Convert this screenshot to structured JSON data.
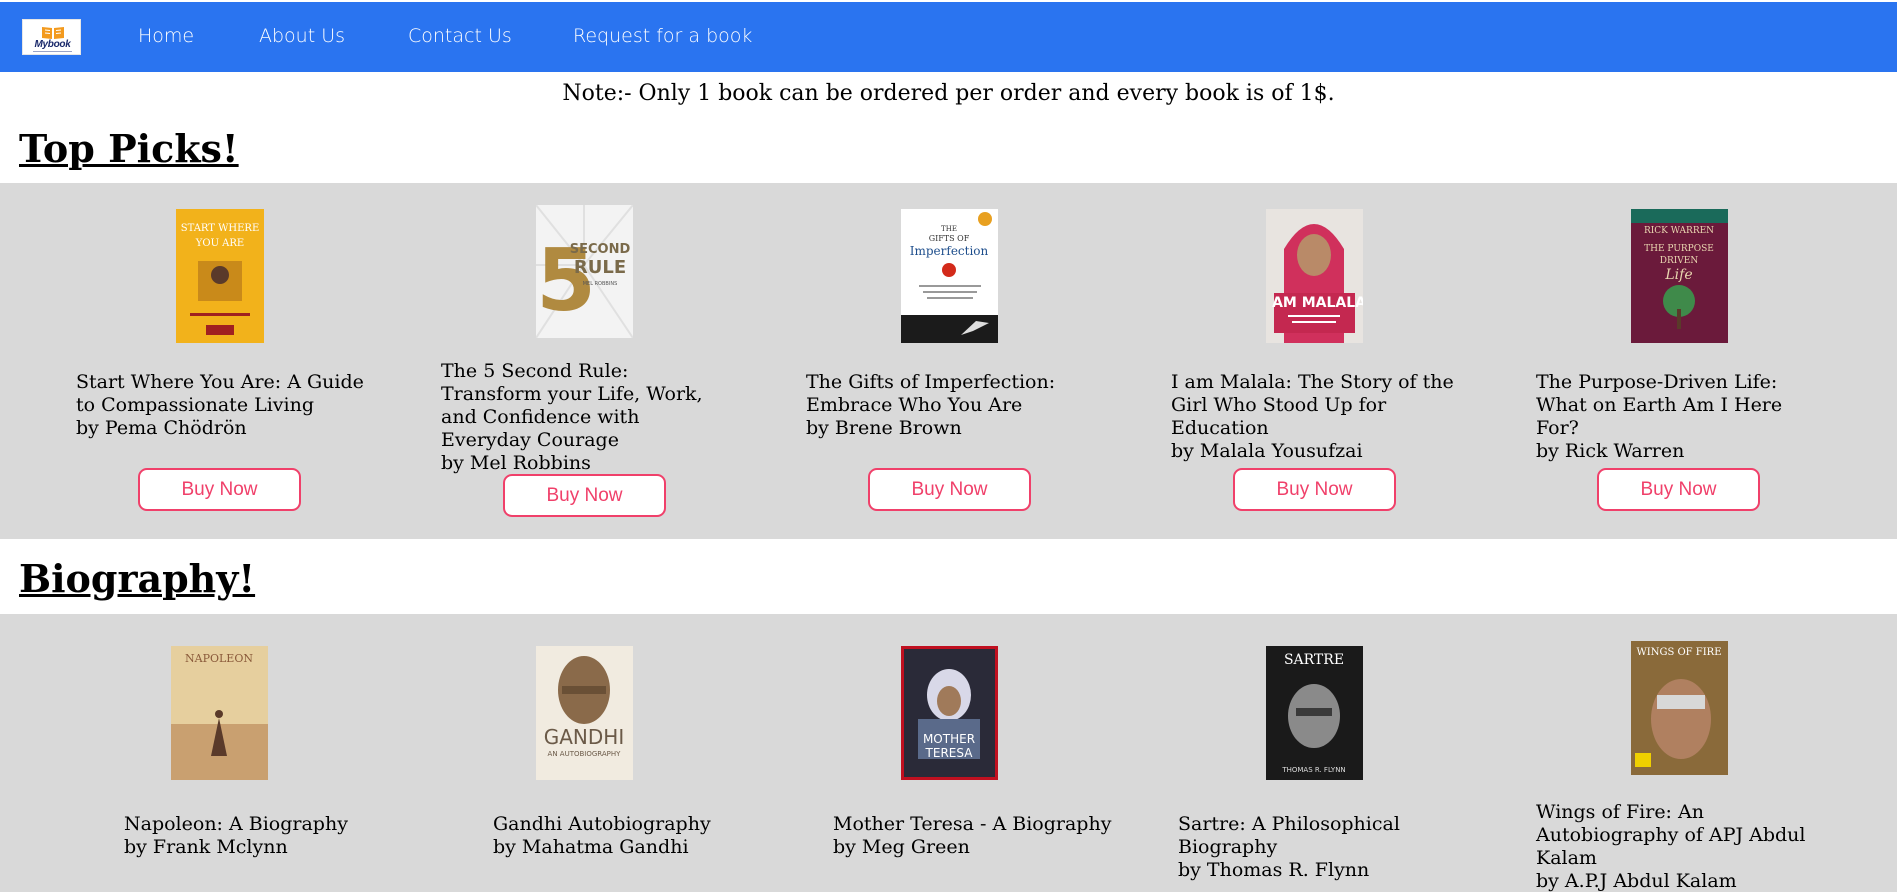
{
  "nav": {
    "logo_text": "Mybook",
    "links": [
      "Home",
      "About Us",
      "Contact Us",
      "Request for a book"
    ]
  },
  "note": "Note:- Only 1 book can be ordered per order and every book is of 1$.",
  "top_picks": {
    "title": "Top Picks!",
    "books": [
      {
        "title": "Start Where You Are: A Guide to Compassionate Living",
        "author": "by Pema Chödrön",
        "button": "Buy Now",
        "cover": {
          "bg": "#f2b21b",
          "text": "START WHERE YOU ARE",
          "fg": "#ffffff"
        }
      },
      {
        "title": "The 5 Second Rule: Transform your Life, Work, and Confidence with Everyday Courage",
        "author": "by Mel Robbins",
        "button": "Buy Now",
        "cover": {
          "bg": "#f3f3f3",
          "text": "5 SECOND RULE",
          "fg": "#8a6a2a"
        }
      },
      {
        "title": "The Gifts of Imperfection: Embrace Who You Are",
        "author": "by Brene Brown",
        "button": "Buy Now",
        "cover": {
          "bg": "#ffffff",
          "text": "THE GIFTS OF Imperfection",
          "fg": "#1e4e8c"
        }
      },
      {
        "title": "I am Malala: The Story of the Girl Who Stood Up for Education",
        "author": "by Malala Yousufzai",
        "button": "Buy Now",
        "cover": {
          "bg": "#d0305c",
          "text": "I AM MALALA",
          "fg": "#ffffff"
        }
      },
      {
        "title": "The Purpose-Driven Life: What on Earth Am I Here For?",
        "author": "by Rick Warren",
        "button": "Buy Now",
        "cover": {
          "bg": "#6b1a3b",
          "text": "THE PURPOSE DRIVEN Life",
          "fg": "#e9d6b0"
        }
      }
    ]
  },
  "biography": {
    "title": "Biography!",
    "books": [
      {
        "title": "Napoleon: A Biography",
        "author": "by Frank Mclynn",
        "cover": {
          "bg": "#e6cf9e",
          "text": "NAPOLEON",
          "fg": "#6b4a2a"
        }
      },
      {
        "title": "Gandhi Autobiography",
        "author": "by Mahatma Gandhi",
        "cover": {
          "bg": "#f1ebe0",
          "text": "GANDHI",
          "fg": "#6b5a48"
        }
      },
      {
        "title": "Mother Teresa - A Biography",
        "author": "by Meg Green",
        "cover": {
          "bg": "#2a2a38",
          "text": "MOTHER TERESA",
          "fg": "#ffffff"
        }
      },
      {
        "title": "Sartre: A Philosophical Biography",
        "author": "by Thomas R. Flynn",
        "cover": {
          "bg": "#1a1a1a",
          "text": "SARTRE",
          "fg": "#ffffff"
        }
      },
      {
        "title": "Wings of Fire: An Autobiography of APJ Abdul Kalam",
        "author": "by A.P.J Abdul Kalam",
        "cover": {
          "bg": "#8a6a3a",
          "text": "WINGS OF FIRE",
          "fg": "#ffffff"
        }
      }
    ]
  },
  "colors": {
    "navbar": "#2a74f0",
    "band": "#d9d9d9",
    "button_accent": "#f0406a"
  }
}
